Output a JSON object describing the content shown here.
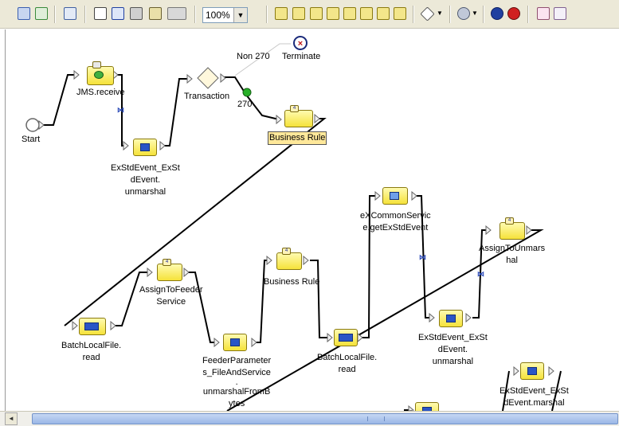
{
  "toolbar": {
    "zoom_value": "100%",
    "icons": [
      "select-link-icon",
      "navigate-icon",
      "refresh-icon",
      "validate-icon",
      "edit-icon",
      "print-icon",
      "align-icon",
      "layout-icon",
      "activity-icon",
      "folder-icon",
      "new-node-icon",
      "receive-icon",
      "send-icon",
      "map-icon",
      "decision-icon",
      "while-icon",
      "loop-icon",
      "flow-icon",
      "gear-icon",
      "stop-icon",
      "cancel-icon",
      "collapse-icon",
      "expand-icon"
    ]
  },
  "diagram": {
    "start": "Start",
    "jms_receive": "JMS.receive",
    "unmarshal_1": [
      "ExStdEvent_ExSt",
      "dEvent.",
      "unmarshal"
    ],
    "transaction": "Transaction",
    "non270": "Non 270",
    "terminate": "Terminate",
    "label_270": "270",
    "business_rule_1": "Business Rule",
    "batch_read_1": [
      "BatchLocalFile.",
      "read"
    ],
    "assign_feeder": [
      "AssignToFeeder",
      "Service"
    ],
    "feeder_params": [
      "FeederParameter",
      "s_FileAndService",
      ".",
      "unmarshalFromB",
      "ytes"
    ],
    "business_rule_2": "Business Rule",
    "batch_read_2": [
      "BatchLocalFile.",
      "read"
    ],
    "common_service": [
      "eXCommonServic",
      "e.getExStdEvent"
    ],
    "unmarshal_2": [
      "ExStdEvent_ExSt",
      "dEvent.",
      "unmarshal"
    ],
    "assign_unmarshal": [
      "AssignToUnmars",
      "hal"
    ],
    "marshal": [
      "ExStdEvent_ExSt",
      "dEvent.marshal"
    ]
  },
  "scrollbar": {
    "left_arrow": "◄",
    "right_arrow": "►"
  },
  "colors": {
    "node_fill": "#f5e23a",
    "selection": "#ffe89a",
    "scroll_thumb": "#9ab7e6"
  }
}
